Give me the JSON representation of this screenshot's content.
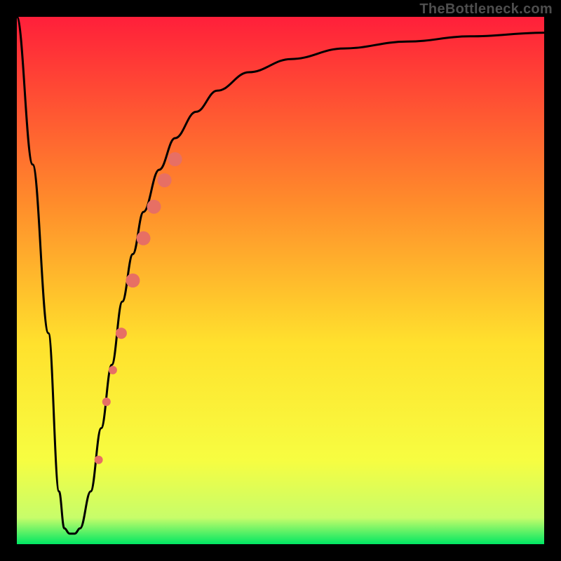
{
  "watermark": "TheBottleneck.com",
  "colors": {
    "gradient_top": "#ff1f3a",
    "gradient_mid1": "#ff8b2b",
    "gradient_mid2": "#ffe12d",
    "gradient_mid3": "#f7fd41",
    "gradient_bottom": "#00e763",
    "curve": "#000000",
    "marker": "#e76f64",
    "frame": "#000000"
  },
  "chart_data": {
    "type": "line",
    "title": "",
    "xlabel": "",
    "ylabel": "",
    "xlim": [
      0,
      100
    ],
    "ylim": [
      0,
      100
    ],
    "series": [
      {
        "name": "bottleneck-curve",
        "x": [
          0,
          3,
          6,
          8,
          9,
          10,
          11,
          12,
          14,
          16,
          18,
          20,
          22,
          24,
          27,
          30,
          34,
          38,
          44,
          52,
          62,
          74,
          86,
          100
        ],
        "y": [
          100,
          72,
          40,
          10,
          3,
          2,
          2,
          3,
          10,
          22,
          34,
          46,
          55,
          63,
          71,
          77,
          82,
          86,
          89.5,
          92,
          94,
          95.3,
          96.3,
          97
        ]
      }
    ],
    "markers": {
      "name": "highlight-dots",
      "x": [
        15.5,
        17.0,
        18.2,
        19.8,
        22.0,
        24.0,
        26.0,
        28.0,
        30.0
      ],
      "y": [
        16.0,
        27.0,
        33.0,
        40.0,
        50.0,
        58.0,
        64.0,
        69.0,
        73.0
      ],
      "size": [
        6,
        6,
        6,
        8,
        10,
        10,
        10,
        10,
        10
      ]
    }
  }
}
